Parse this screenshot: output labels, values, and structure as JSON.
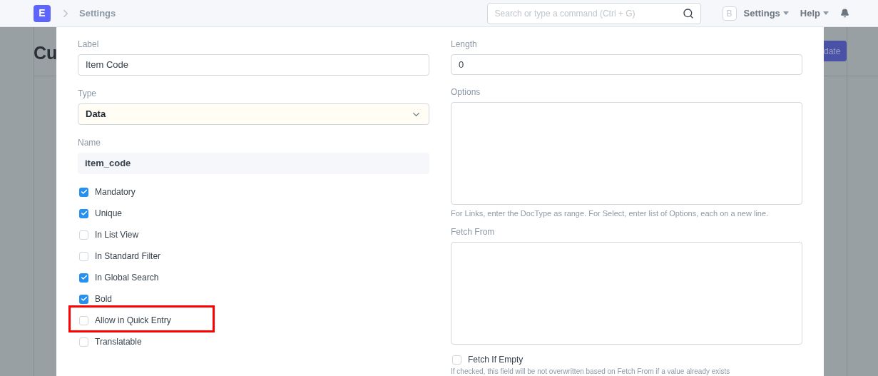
{
  "navbar": {
    "logo": "E",
    "breadcrumb": "Settings",
    "search": {
      "placeholder": "Search or type a command (Ctrl + G)"
    },
    "avatar": "B",
    "menus": [
      "Settings",
      "Help"
    ]
  },
  "background_page": {
    "title": "Cu",
    "button": "date"
  },
  "dialog": {
    "left": {
      "label": {
        "label": "Label",
        "value": "Item Code"
      },
      "type": {
        "label": "Type",
        "value": "Data"
      },
      "name": {
        "label": "Name",
        "value": "item_code"
      },
      "checks": [
        {
          "label": "Mandatory",
          "checked": true,
          "highlighted": false
        },
        {
          "label": "Unique",
          "checked": true,
          "highlighted": false
        },
        {
          "label": "In List View",
          "checked": false,
          "highlighted": false
        },
        {
          "label": "In Standard Filter",
          "checked": false,
          "highlighted": false
        },
        {
          "label": "In Global Search",
          "checked": true,
          "highlighted": false
        },
        {
          "label": "Bold",
          "checked": true,
          "highlighted": false
        },
        {
          "label": "Allow in Quick Entry",
          "checked": false,
          "highlighted": true
        },
        {
          "label": "Translatable",
          "checked": false,
          "highlighted": false
        }
      ]
    },
    "right": {
      "length": {
        "label": "Length",
        "value": "0"
      },
      "options": {
        "label": "Options",
        "help": "For Links, enter the DocType as range. For Select, enter list of Options, each on a new line."
      },
      "fetch_from": {
        "label": "Fetch From"
      },
      "fetch_if_empty": {
        "label": "Fetch If Empty",
        "checked": false,
        "help": "If checked, this field will be not overwritten based on Fetch From if a value already exists"
      }
    }
  }
}
